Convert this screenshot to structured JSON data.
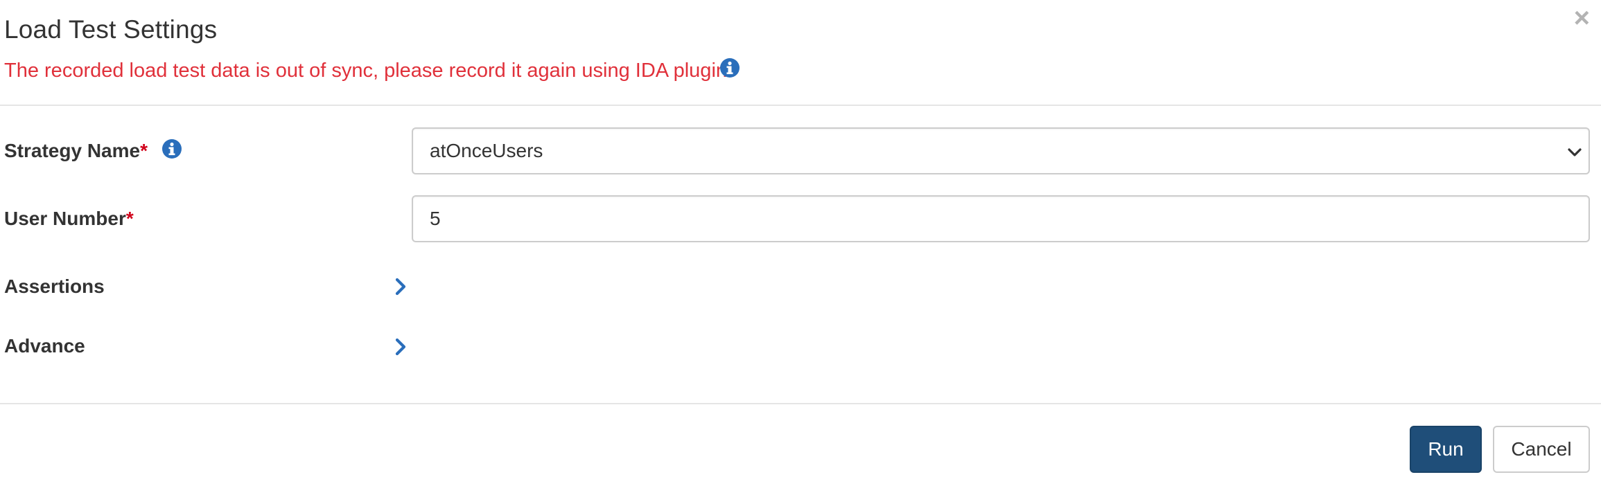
{
  "dialog": {
    "title": "Load Test Settings",
    "close_symbol": "×",
    "warning": "The recorded load test data is out of sync, please record it again using IDA plugin.",
    "warning_color": "#e0303a"
  },
  "form": {
    "strategy": {
      "label": "Strategy Name",
      "required_mark": "*",
      "selected": "atOnceUsers",
      "icon": "info-circle-icon"
    },
    "user_number": {
      "label": "User Number",
      "required_mark": "*",
      "value": "5"
    },
    "assertions": {
      "label": "Assertions",
      "icon": "chevron-right-icon"
    },
    "advance": {
      "label": "Advance",
      "icon": "chevron-right-icon"
    }
  },
  "footer": {
    "run_label": "Run",
    "cancel_label": "Cancel"
  },
  "colors": {
    "primary": "#1f4e79",
    "accent_icon": "#2a6ebb",
    "required": "#d0021b"
  }
}
